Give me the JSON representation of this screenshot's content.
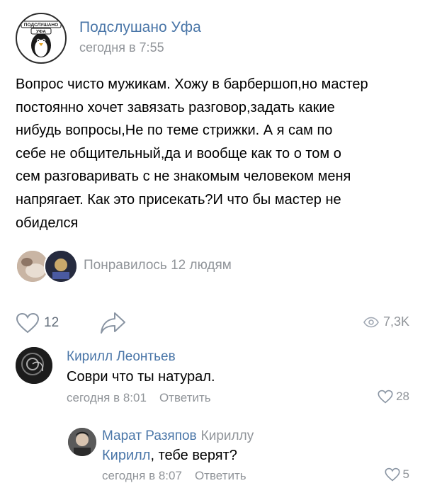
{
  "post": {
    "group_name": "Подслушано Уфа",
    "time": "сегодня в 7:55",
    "avatar_text_top": "ПОДСЛУШАНО",
    "avatar_text_bottom": "УФА",
    "text_lines": [
      "Вопрос чисто мужикам. Хожу в барбершоп,но мастер",
      "постоянно хочет завязать разговор,задать какие",
      "нибудь вопросы,Не по теме стрижки. А я сам по",
      "себе не общительный,да и вообще как то о том о",
      "сем разговаривать с не знакомым человеком меня",
      "напрягает. Как это присекать?И что бы мастер не",
      "обиделся"
    ],
    "likes_summary": "Понравилось 12 людям",
    "like_icon": "heart-icon",
    "like_count": "12",
    "share_icon": "share-arrow-icon",
    "views_icon": "eye-icon",
    "views_count": "7,3K"
  },
  "comments": [
    {
      "author": "Кирилл Леонтьев",
      "text": "Соври что ты натурал.",
      "time": "сегодня в 8:01",
      "reply_label": "Ответить",
      "likes": "28"
    },
    {
      "author": "Марат Разяпов",
      "reply_to": "Кириллу",
      "mention": "Кирилл",
      "text": ", тебе верят?",
      "time": "сегодня в 8:07",
      "reply_label": "Ответить",
      "likes": "5"
    }
  ],
  "colors": {
    "link_blue": "#4a76a8",
    "meta_gray": "#909499",
    "background": "#ffffff"
  }
}
